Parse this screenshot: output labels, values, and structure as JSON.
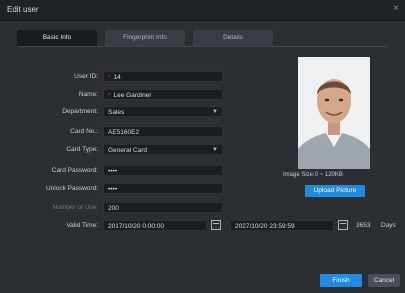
{
  "window": {
    "title": "Edit user",
    "close_glyph": "×"
  },
  "tabs": [
    {
      "label": "Basic Info",
      "active": true
    },
    {
      "label": "Fingerprint Info",
      "active": false
    },
    {
      "label": "Details",
      "active": false
    }
  ],
  "form": {
    "user_id": {
      "label": "User ID:",
      "value": "14"
    },
    "name": {
      "label": "Name:",
      "value": "Lee Gardiner"
    },
    "department": {
      "label": "Department:",
      "value": "Sales"
    },
    "card_no": {
      "label": "Card No.:",
      "value": "AE5160E2"
    },
    "card_type": {
      "label": "Card Type:",
      "value": "General Card"
    },
    "card_password": {
      "label": "Card Password:",
      "value": "••••"
    },
    "unlock_password": {
      "label": "Unlock Password:",
      "value": "••••"
    },
    "number_of_use": {
      "label": "Number of Use:",
      "value": "200"
    },
    "valid_time": {
      "label": "Valid Time:",
      "start": "2017/10/20 0:00:00",
      "end": "2027/10/20 23:59:59",
      "days_value": "3653",
      "days_label": "Days"
    }
  },
  "photo": {
    "image_size_text": "Image Size:0 ~ 120KB",
    "upload_label": "Upload Picture"
  },
  "footer": {
    "finish_label": "Finish",
    "cancel_label": "Cancel"
  },
  "colors": {
    "accent": "#1e8be0",
    "required": "#d63b3b"
  }
}
